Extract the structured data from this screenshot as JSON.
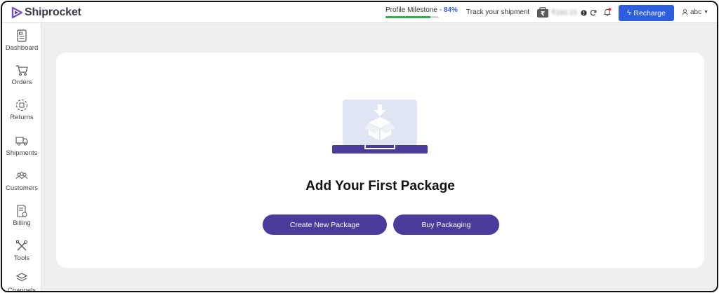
{
  "header": {
    "logo_text": "Shiprocket",
    "milestone_label": "Profile Milestone - ",
    "milestone_pct": "84%",
    "milestone_progress": 0.84,
    "track_label": "Track your shipment",
    "wallet_amount": "₹160.15",
    "recharge_label": "Recharge",
    "user_name": "abc"
  },
  "sidebar": {
    "items": [
      {
        "label": "Dashboard",
        "icon": "dashboard-icon"
      },
      {
        "label": "Orders",
        "icon": "cart-icon"
      },
      {
        "label": "Returns",
        "icon": "returns-icon"
      },
      {
        "label": "Shipments",
        "icon": "truck-icon"
      },
      {
        "label": "Customers",
        "icon": "customers-icon"
      },
      {
        "label": "Billing",
        "icon": "billing-icon"
      },
      {
        "label": "Tools",
        "icon": "tools-icon"
      },
      {
        "label": "Channels",
        "icon": "channels-icon"
      }
    ]
  },
  "main": {
    "title": "Add Your First Package",
    "create_button": "Create New Package",
    "buy_button": "Buy Packaging"
  },
  "colors": {
    "brand_purple": "#4b3b9b",
    "recharge_blue": "#2e5ee0",
    "progress_green": "#2db34a",
    "milestone_blue": "#2e63d9"
  }
}
